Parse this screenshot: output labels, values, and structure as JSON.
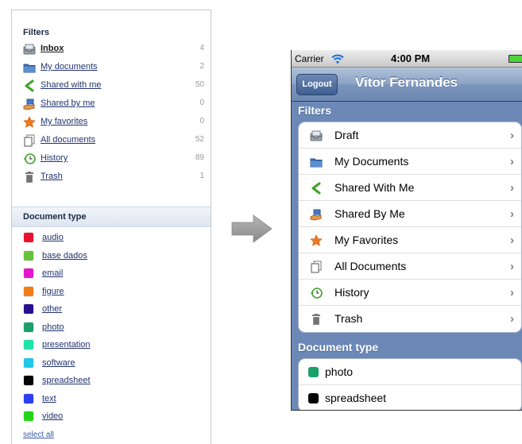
{
  "web": {
    "filters_heading": "Filters",
    "filters": [
      {
        "label": "Inbox",
        "count": "4",
        "icon": "inbox-icon",
        "bold": true
      },
      {
        "label": "My documents",
        "count": "2",
        "icon": "folder-icon"
      },
      {
        "label": "Shared with me",
        "count": "50",
        "icon": "share-icon"
      },
      {
        "label": "Shared by me",
        "count": "0",
        "icon": "hand-share-icon"
      },
      {
        "label": "My favorites",
        "count": "0",
        "icon": "star-icon"
      },
      {
        "label": "All documents",
        "count": "52",
        "icon": "documents-icon"
      },
      {
        "label": "History",
        "count": "89",
        "icon": "history-icon"
      },
      {
        "label": "Trash",
        "count": "1",
        "icon": "trash-icon"
      }
    ],
    "doctype_heading": "Document type",
    "doc_types": [
      {
        "label": "audio",
        "color": "#e8112d"
      },
      {
        "label": "base dados",
        "color": "#67c23a"
      },
      {
        "label": "email",
        "color": "#e516c9"
      },
      {
        "label": "figure",
        "color": "#f07d19"
      },
      {
        "label": "other",
        "color": "#2a0f8f"
      },
      {
        "label": "photo",
        "color": "#1aa06a"
      },
      {
        "label": "presentation",
        "color": "#1fe3a9"
      },
      {
        "label": "software",
        "color": "#21c6e8"
      },
      {
        "label": "spreadsheet",
        "color": "#050505"
      },
      {
        "label": "text",
        "color": "#2b3ef0"
      },
      {
        "label": "video",
        "color": "#23d51a"
      }
    ],
    "select_all": "select all"
  },
  "phone": {
    "carrier": "Carrier",
    "time": "4:00 PM",
    "logout_label": "Logout",
    "title": "Vitor Fernandes",
    "filters_heading": "Filters",
    "filters": [
      {
        "label": "Draft",
        "icon": "inbox-icon"
      },
      {
        "label": "My Documents",
        "icon": "folder-icon"
      },
      {
        "label": "Shared With Me",
        "icon": "share-icon"
      },
      {
        "label": "Shared By Me",
        "icon": "hand-share-icon"
      },
      {
        "label": "My Favorites",
        "icon": "star-icon"
      },
      {
        "label": "All Documents",
        "icon": "documents-icon"
      },
      {
        "label": "History",
        "icon": "history-icon"
      },
      {
        "label": "Trash",
        "icon": "trash-icon"
      }
    ],
    "doctype_heading": "Document type",
    "doc_types": [
      {
        "label": "photo",
        "color": "#1aa06a"
      },
      {
        "label": "spreadsheet",
        "color": "#050505"
      }
    ]
  }
}
